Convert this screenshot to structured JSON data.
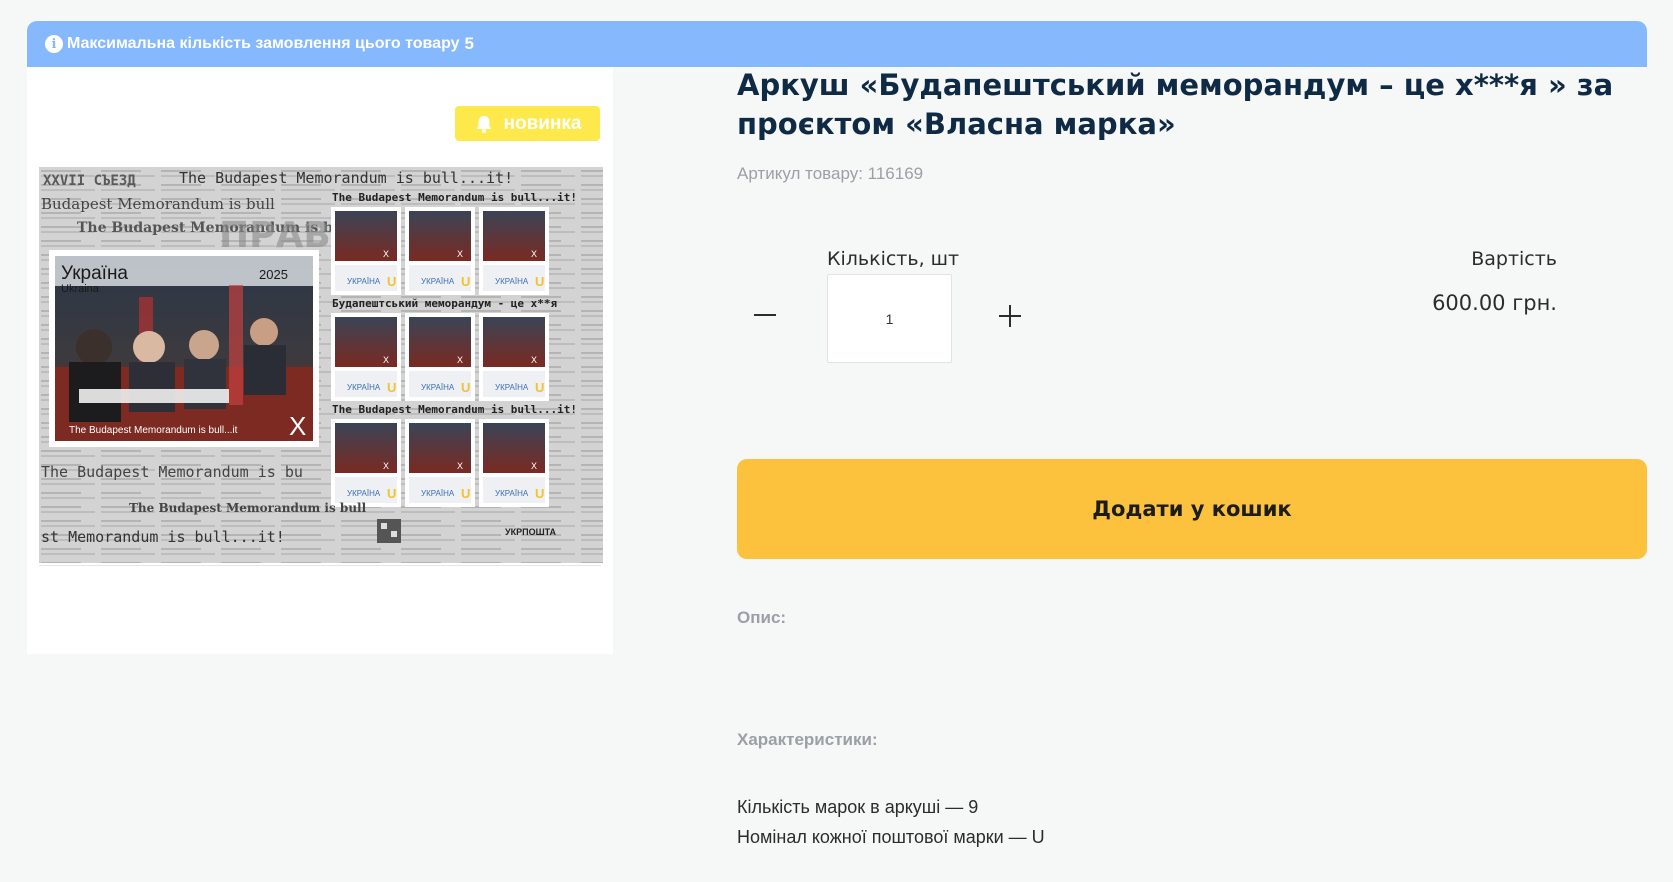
{
  "banner": {
    "text": "Максимальна кількість замовлення цього товару",
    "max_qty": "5",
    "icon": "info-icon"
  },
  "product": {
    "badge": "новинка",
    "badge_icon": "bell-icon",
    "title": "Аркуш «Будапештський меморандум – це х***я » за проєктом «Власна марка»",
    "sku": "Артикул товару: 116169"
  },
  "sheet": {
    "country": "Україна",
    "country_latin": "Ukraina",
    "year": "2025",
    "nominal": "X",
    "stamp_caption": "The Budapest Memorandum is bull...it",
    "header_line": "The Budapest Memorandum is bull...it!",
    "middle_line": "Будапештський меморандум - це х**я",
    "mini_label": "УКРАЇНА",
    "mini_nominal": "U",
    "postal": "УКРПОШТА"
  },
  "purchase": {
    "qty_label": "Кількість, шт",
    "qty_value": "1",
    "price_label": "Вартість",
    "price_value": "600.00 грн.",
    "add_to_cart": "Додати у кошик"
  },
  "details": {
    "description_label": "Опис:",
    "characteristics_label": "Характеристики:",
    "characteristics": [
      "Кількість марок в аркуші — 9",
      "Номінал кожної поштової марки — U"
    ]
  },
  "colors": {
    "banner": "#85b8fc",
    "badge": "#fde94c",
    "cart_button": "#fcc23d",
    "title": "#0f2a44"
  }
}
